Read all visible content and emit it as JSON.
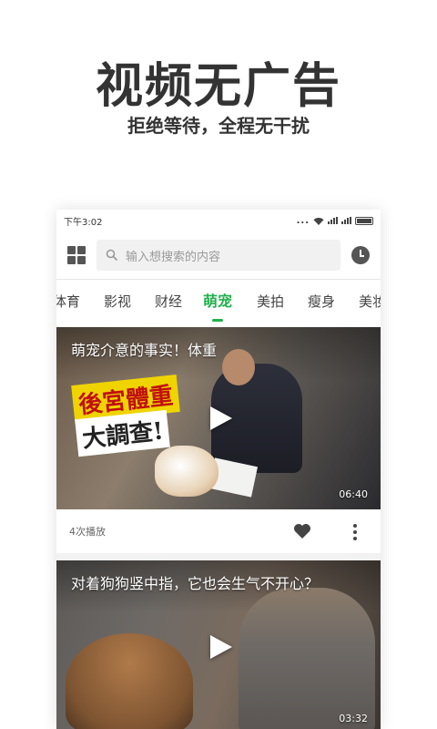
{
  "promo": {
    "title": "视频无广告",
    "subtitle": "拒绝等待，全程无干扰"
  },
  "statusbar": {
    "time": "下午3:02",
    "dots": "..."
  },
  "search": {
    "placeholder": "输入想搜索的内容"
  },
  "tabs": [
    {
      "label": "体育",
      "active": false
    },
    {
      "label": "影视",
      "active": false
    },
    {
      "label": "财经",
      "active": false
    },
    {
      "label": "萌宠",
      "active": true
    },
    {
      "label": "美拍",
      "active": false
    },
    {
      "label": "瘦身",
      "active": false
    },
    {
      "label": "美妆",
      "active": false
    }
  ],
  "videos": [
    {
      "title": "萌宠介意的事实！体重",
      "overlay_line1": "後宮體重",
      "overlay_line2": "大調查!",
      "duration": "06:40",
      "play_count": "4次播放"
    },
    {
      "title": "对着狗狗竖中指，它也会生气不开心？",
      "duration": "03:32"
    }
  ],
  "colors": {
    "accent": "#22b14c",
    "text_dark": "#333333"
  }
}
